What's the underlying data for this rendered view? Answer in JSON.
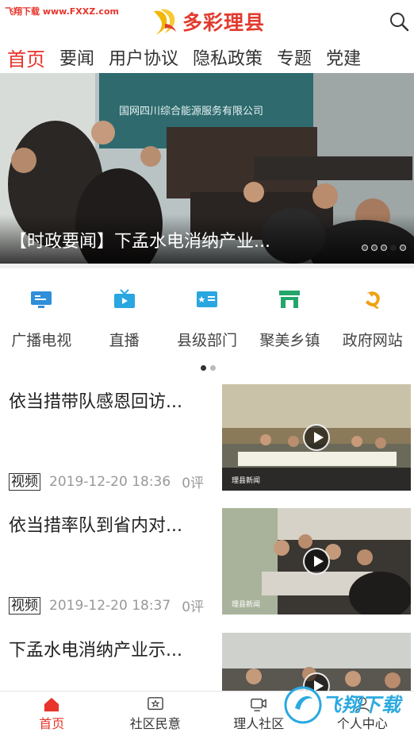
{
  "watermark_top": "飞翔下载 www.FXXZ.com",
  "header": {
    "app_name": "多彩理县",
    "search_icon": "search-icon"
  },
  "tabs": [
    {
      "label": "首页",
      "active": true
    },
    {
      "label": "要闻"
    },
    {
      "label": "用户协议"
    },
    {
      "label": "隐私政策"
    },
    {
      "label": "专题"
    },
    {
      "label": "党建"
    }
  ],
  "banner": {
    "title": "【时政要闻】下孟水电消纳产业...",
    "backdrop_text": "国网四川综合能源服务有限公司",
    "slide_count": 5,
    "active_slide": 4
  },
  "grid": [
    {
      "label": "广播电视",
      "icon": "tv-broadcast-icon",
      "color": "#2f8fd8"
    },
    {
      "label": "直播",
      "icon": "live-tv-icon",
      "color": "#2aa6e0"
    },
    {
      "label": "县级部门",
      "icon": "department-card-icon",
      "color": "#2aa6e0"
    },
    {
      "label": "聚美乡镇",
      "icon": "township-store-icon",
      "color": "#22a66a"
    },
    {
      "label": "政府网站",
      "icon": "party-emblem-icon",
      "color": "#f0a010"
    }
  ],
  "grid_pager": {
    "pages": 2,
    "active": 1
  },
  "news": [
    {
      "title": "依当措带队感恩回访...",
      "tag": "视频",
      "time": "2019-12-20 18:36",
      "comments": "0评"
    },
    {
      "title": "依当措率队到省内对...",
      "tag": "视频",
      "time": "2019-12-20 18:37",
      "comments": "0评"
    },
    {
      "title": "下孟水电消纳产业示...",
      "tag": "",
      "time": "",
      "comments": ""
    }
  ],
  "thumb_caption": "理县新闻",
  "bottom_nav": [
    {
      "label": "首页",
      "icon": "home-icon",
      "active": true
    },
    {
      "label": "社区民意",
      "icon": "community-opinion-icon"
    },
    {
      "label": "理人社区",
      "icon": "community-video-icon"
    },
    {
      "label": "个人中心",
      "icon": "user-center-icon"
    }
  ],
  "watermark_bottom": "飞翔下载",
  "colors": {
    "accent": "#e8342a",
    "brand_yellow": "#f2b705",
    "watermark_blue": "#2aa9e0"
  }
}
